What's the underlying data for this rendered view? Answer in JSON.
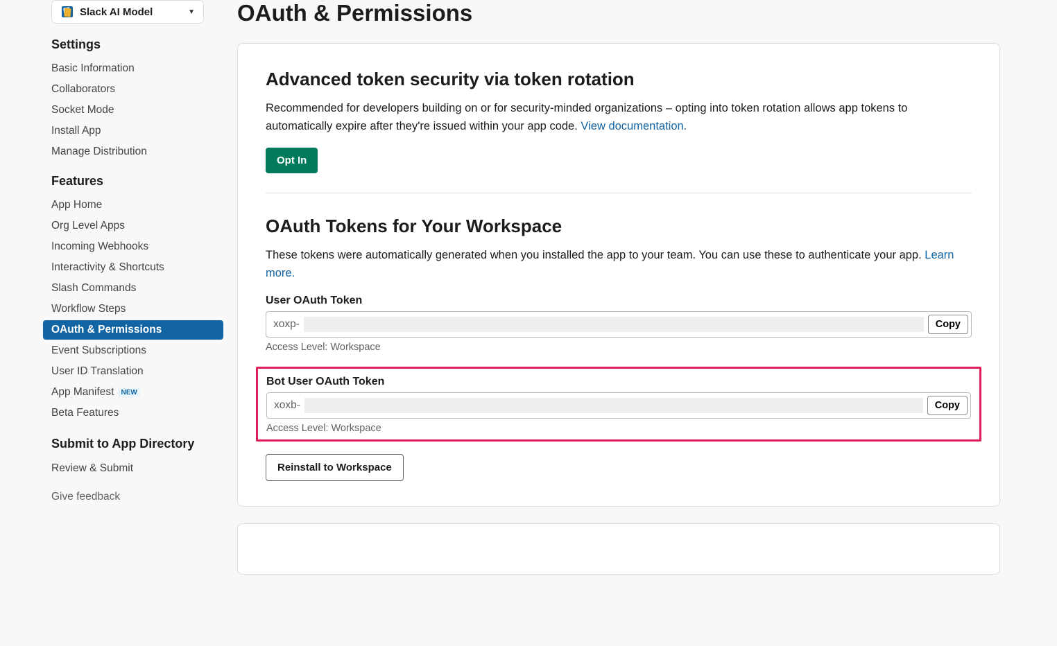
{
  "appSelector": {
    "name": "Slack AI Model"
  },
  "sidebar": {
    "settings": {
      "heading": "Settings",
      "items": [
        {
          "label": "Basic Information"
        },
        {
          "label": "Collaborators"
        },
        {
          "label": "Socket Mode"
        },
        {
          "label": "Install App"
        },
        {
          "label": "Manage Distribution"
        }
      ]
    },
    "features": {
      "heading": "Features",
      "items": [
        {
          "label": "App Home"
        },
        {
          "label": "Org Level Apps"
        },
        {
          "label": "Incoming Webhooks"
        },
        {
          "label": "Interactivity & Shortcuts"
        },
        {
          "label": "Slash Commands"
        },
        {
          "label": "Workflow Steps"
        },
        {
          "label": "OAuth & Permissions",
          "active": true
        },
        {
          "label": "Event Subscriptions"
        },
        {
          "label": "User ID Translation"
        },
        {
          "label": "App Manifest",
          "badge": "NEW"
        },
        {
          "label": "Beta Features"
        }
      ]
    },
    "submit": {
      "heading": "Submit to App Directory",
      "items": [
        {
          "label": "Review & Submit"
        }
      ]
    },
    "feedbackLabel": "Give feedback"
  },
  "page": {
    "title": "OAuth & Permissions",
    "tokenRotation": {
      "heading": "Advanced token security via token rotation",
      "body": "Recommended for developers building on or for security-minded organizations – opting into token rotation allows app tokens to automatically expire after they're issued within your app code. ",
      "docLink": "View documentation.",
      "optIn": "Opt In"
    },
    "oauthTokens": {
      "heading": "OAuth Tokens for Your Workspace",
      "body": "These tokens were automatically generated when you installed the app to your team. You can use these to authenticate your app. ",
      "learnMore": "Learn more.",
      "userToken": {
        "label": "User OAuth Token",
        "prefix": "xoxp-",
        "copy": "Copy",
        "access": "Access Level: Workspace"
      },
      "botToken": {
        "label": "Bot User OAuth Token",
        "prefix": "xoxb-",
        "copy": "Copy",
        "access": "Access Level: Workspace"
      },
      "reinstall": "Reinstall to Workspace"
    }
  }
}
